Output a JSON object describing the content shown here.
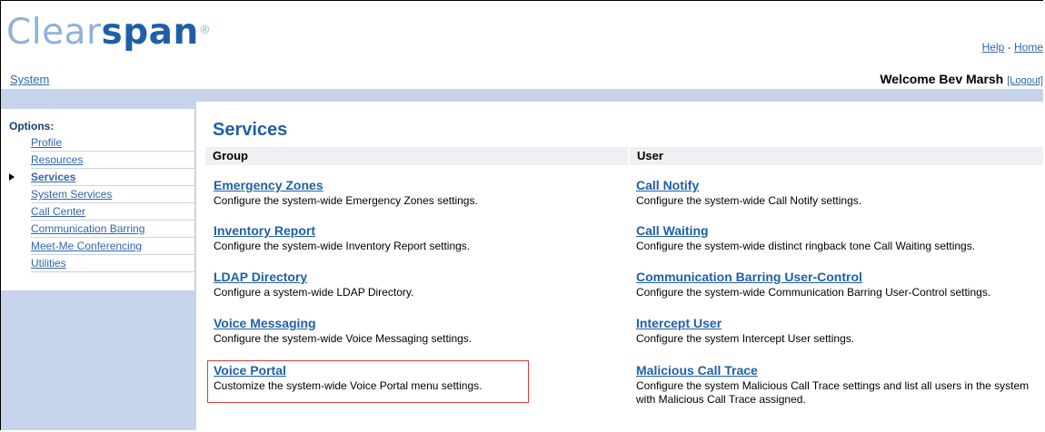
{
  "header": {
    "logo_light": "Clear",
    "logo_dark": "span",
    "logo_mark": "®",
    "help_link": "Help",
    "separator": " - ",
    "home_link": "Home",
    "breadcrumb": "System",
    "welcome": "Welcome Bev Marsh",
    "logout": "[Logout]"
  },
  "sidebar": {
    "title": "Options:",
    "items": [
      {
        "label": "Profile"
      },
      {
        "label": "Resources"
      },
      {
        "label": "Services"
      },
      {
        "label": "System Services"
      },
      {
        "label": "Call Center"
      },
      {
        "label": "Communication Barring"
      },
      {
        "label": "Meet-Me Conferencing"
      },
      {
        "label": "Utilities"
      }
    ],
    "active_index": 2
  },
  "main": {
    "title": "Services",
    "group_header": "Group",
    "user_header": "User",
    "group_items": [
      {
        "name": "Emergency Zones",
        "desc": "Configure the system-wide Emergency Zones settings."
      },
      {
        "name": "Inventory Report",
        "desc": "Configure the system-wide Inventory Report settings."
      },
      {
        "name": "LDAP Directory",
        "desc": "Configure a system-wide LDAP Directory."
      },
      {
        "name": "Voice Messaging",
        "desc": "Configure the system-wide Voice Messaging settings."
      },
      {
        "name": "Voice Portal",
        "desc": "Customize the system-wide Voice Portal menu settings."
      }
    ],
    "user_items": [
      {
        "name": "Call Notify",
        "desc": "Configure the system-wide Call Notify settings."
      },
      {
        "name": "Call Waiting",
        "desc": "Configure the system-wide distinct ringback tone Call Waiting settings."
      },
      {
        "name": "Communication Barring User-Control",
        "desc": "Configure the system-wide Communication Barring User-Control settings."
      },
      {
        "name": "Intercept User",
        "desc": "Configure the system Intercept User settings."
      },
      {
        "name": "Malicious Call Trace",
        "desc": "Configure the system Malicious Call Trace settings and list all users in the system with Malicious Call Trace assigned."
      }
    ]
  },
  "colors": {
    "brand": "#1f5fa8",
    "link": "#3366aa",
    "panel": "#c5d4ea",
    "highlight": "#e23a3a"
  }
}
